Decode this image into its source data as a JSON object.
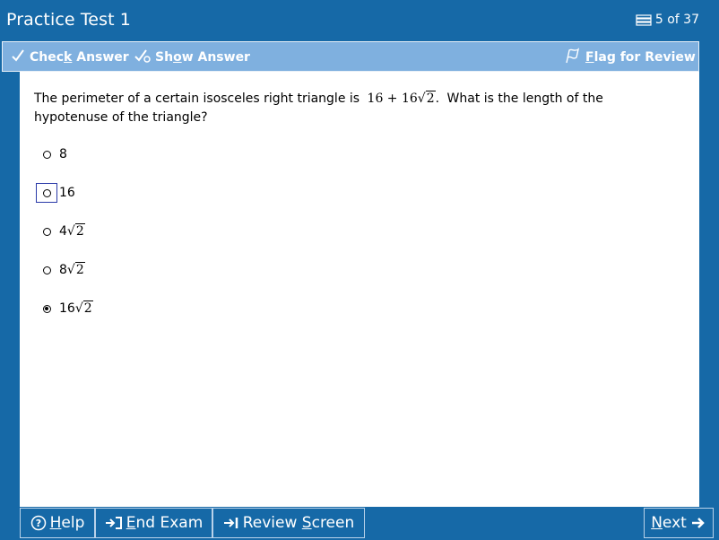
{
  "header": {
    "title": "Practice Test 1",
    "counter": "5 of 37"
  },
  "toolbar": {
    "check_answer_pre": "Chec",
    "check_answer_ul": "k",
    "check_answer_post": " Answer",
    "show_answer_pre": "Sh",
    "show_answer_ul": "o",
    "show_answer_post": "w Answer",
    "flag_ul": "F",
    "flag_post": "lag for Review"
  },
  "question": {
    "text_before": "The perimeter of a certain isosceles right triangle is",
    "math_a": "16 + 16",
    "math_rad": "2",
    "math_after": ".",
    "text_after": "What is the length of the hypotenuse of the triangle?"
  },
  "options": [
    {
      "coef": "8",
      "rad": ""
    },
    {
      "coef": "16",
      "rad": ""
    },
    {
      "coef": "4",
      "rad": "2"
    },
    {
      "coef": "8",
      "rad": "2"
    },
    {
      "coef": "16",
      "rad": "2"
    }
  ],
  "selected_option": 4,
  "focused_option": 1,
  "bottom": {
    "help_ul": "H",
    "help_post": "elp",
    "end_ul": "E",
    "end_post": "nd Exam",
    "review_pre": "Review ",
    "review_ul": "S",
    "review_post": "creen",
    "next_ul": "N",
    "next_post": "ext"
  },
  "colors": {
    "frame": "#1669a7",
    "toolbar": "#7fb0df",
    "content": "#ffffff"
  },
  "icons": {
    "counter": "stack-icon",
    "check": "check-pencil-icon",
    "show": "show-answer-icon",
    "flag": "flag-icon",
    "help": "question-circle-icon",
    "end": "exit-arrow-icon",
    "review": "arrow-bar-icon",
    "next": "arrow-right-icon"
  }
}
